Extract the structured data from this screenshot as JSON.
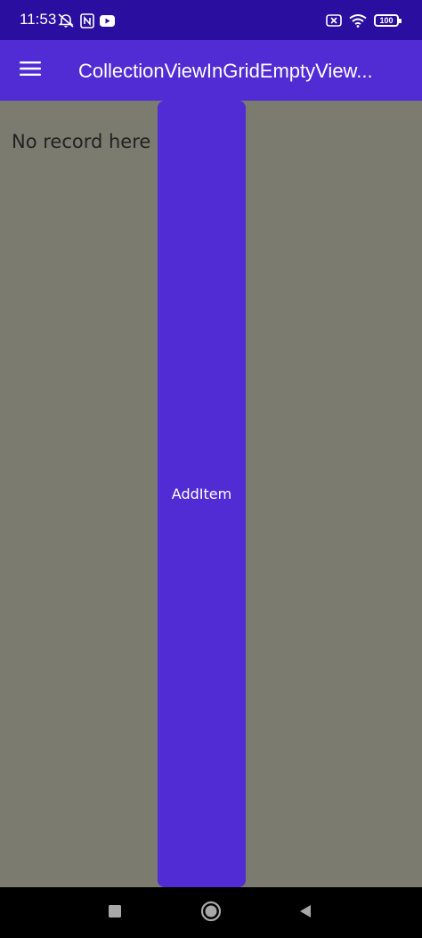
{
  "status_bar": {
    "time": "11:53",
    "battery": "100",
    "left_icons": [
      "alarm-off-icon",
      "nfc-icon",
      "youtube-icon"
    ],
    "right_icons": [
      "sim-off-icon",
      "wifi-icon",
      "battery-icon"
    ]
  },
  "app_bar": {
    "title": "CollectionViewInGridEmptyView...",
    "menu_icon": "hamburger-menu-icon"
  },
  "content": {
    "empty_text": "No record here",
    "add_button_label": "AddItem"
  },
  "nav_bar": {
    "icons": [
      "recents-square-icon",
      "home-circle-icon",
      "back-triangle-icon"
    ]
  },
  "colors": {
    "status_bar": "#2a0ea0",
    "primary": "#512bd4",
    "content_background": "#7b7b70",
    "text_dark": "#222222",
    "nav_background": "#000000"
  }
}
